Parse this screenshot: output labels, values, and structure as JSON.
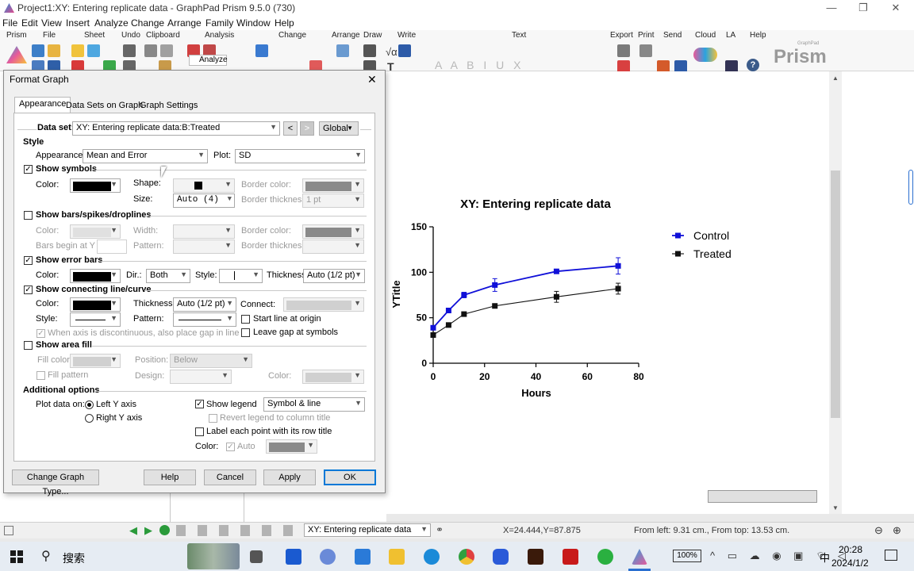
{
  "window": {
    "title": "Project1:XY: Entering replicate data - GraphPad Prism 9.5.0 (730)",
    "controls": {
      "minimize": "—",
      "restore": "❐",
      "close": "✕"
    }
  },
  "menu": [
    "File",
    "Edit",
    "View",
    "Insert",
    "Analyze",
    "Change",
    "Arrange",
    "Family",
    "Window",
    "Help"
  ],
  "ribbon": {
    "groups": [
      "Prism",
      "File",
      "Sheet",
      "Undo",
      "Clipboard",
      "Analysis",
      "Change",
      "Arrange",
      "Draw",
      "Write",
      "Text",
      "Export",
      "Print",
      "Send",
      "Cloud",
      "LA",
      "Help"
    ],
    "analyze_label": "Analyze",
    "brand": "Prism",
    "brand_small": "GraphPad"
  },
  "dialog": {
    "title": "Format Graph",
    "close": "✕",
    "tabs": [
      "Appearance",
      "Data Sets on Graph",
      "Graph Settings"
    ],
    "dataset_label": "Data set:",
    "dataset_value": "XY: Entering replicate data:B:Treated",
    "prev": "<",
    "next": ">",
    "global": "Global",
    "style_header": "Style",
    "appearance_label": "Appearance:",
    "appearance_value": "Mean and Error",
    "plot_label": "Plot:",
    "plot_value": "SD",
    "show_symbols": "Show symbols",
    "color_label": "Color:",
    "shape_label": "Shape:",
    "border_color_label": "Border color:",
    "size_label": "Size:",
    "size_value": "Auto (4)",
    "border_thickness_label": "Border thickness:",
    "border_thickness_value": "1 pt",
    "show_bars": "Show bars/spikes/droplines",
    "width_label": "Width:",
    "bars_begin_label": "Bars begin at Y =",
    "pattern_label": "Pattern:",
    "show_error_bars": "Show error bars",
    "dir_label": "Dir.:",
    "dir_value": "Both",
    "style_label": "Style:",
    "thickness_label": "Thickness:",
    "thickness_value": "Auto (1/2 pt)",
    "show_connecting": "Show connecting line/curve",
    "connect_label": "Connect:",
    "start_origin": "Start line at origin",
    "leave_gap": "Leave gap at symbols",
    "discontinuous": "When axis is discontinuous, also place gap in line",
    "show_area_fill": "Show area fill",
    "fill_color_label": "Fill color:",
    "position_label": "Position:",
    "position_value": "Below",
    "fill_pattern": "Fill pattern",
    "design_label": "Design:",
    "additional_header": "Additional options",
    "plot_data_on": "Plot data on:",
    "left_y": "Left Y axis",
    "right_y": "Right  Y axis",
    "show_legend": "Show legend",
    "legend_value": "Symbol & line",
    "revert_legend": "Revert legend to column title",
    "label_each_point": "Label each point with its row title",
    "auto_label": "Auto",
    "buttons": {
      "change_type": "Change Graph Type...",
      "help": "Help",
      "cancel": "Cancel",
      "apply": "Apply",
      "ok": "OK"
    }
  },
  "chart_data": {
    "type": "line",
    "title": "XY: Entering replicate data",
    "xlabel": "Hours",
    "ylabel": "YTitle",
    "xlim": [
      0,
      80
    ],
    "ylim": [
      0,
      150
    ],
    "xticks": [
      "0",
      "20",
      "40",
      "60",
      "80"
    ],
    "yticks": [
      "0",
      "50",
      "100",
      "150"
    ],
    "grid": false,
    "legend_position": "right",
    "series": [
      {
        "name": "Control",
        "color": "#1010d8",
        "x": [
          0,
          6,
          12,
          24,
          48,
          72
        ],
        "y": [
          39,
          58,
          75,
          86,
          101,
          107
        ],
        "err": [
          2,
          2,
          3,
          7,
          2,
          9
        ]
      },
      {
        "name": "Treated",
        "color": "#111111",
        "x": [
          0,
          6,
          12,
          24,
          48,
          72
        ],
        "y": [
          31,
          42,
          54,
          63,
          73,
          82
        ],
        "err": [
          2,
          2,
          2,
          2,
          6,
          6
        ]
      }
    ]
  },
  "statusbar": {
    "sheet_selector": "XY: Entering replicate data",
    "coords": "X=24.444,Y=87.875",
    "position": "From left: 9.31 cm., From top: 13.53 cm."
  },
  "taskbar": {
    "search": "搜索",
    "battery": "100%",
    "ime": "中",
    "time": "20:28",
    "date": "2024/1/2"
  }
}
